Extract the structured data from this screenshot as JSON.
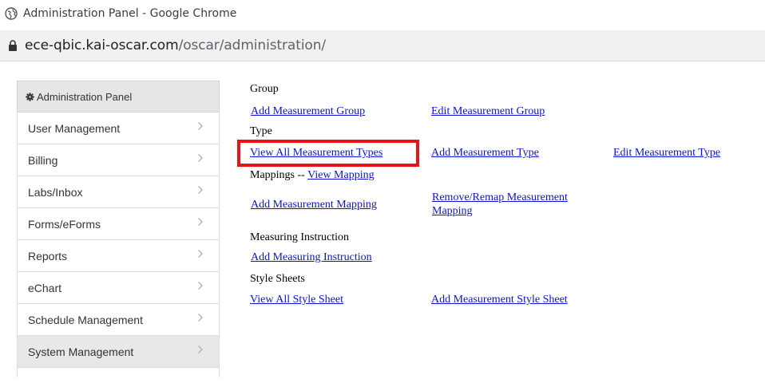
{
  "window": {
    "title": "Administration Panel - Google Chrome"
  },
  "address_bar": {
    "host": "ece-qbic.kai-oscar.com",
    "path": "/oscar/administration/"
  },
  "sidebar": {
    "header": "Administration Panel",
    "items": [
      {
        "label": "User Management"
      },
      {
        "label": "Billing"
      },
      {
        "label": "Labs/Inbox"
      },
      {
        "label": "Forms/eForms"
      },
      {
        "label": "Reports"
      },
      {
        "label": "eChart"
      },
      {
        "label": "Schedule Management"
      },
      {
        "label": "System Management"
      }
    ]
  },
  "content": {
    "group": {
      "heading": "Group",
      "add_link": "Add Measurement Group",
      "edit_link": "Edit Measurement Group"
    },
    "type": {
      "heading": "Type",
      "view_all_link": "View All Measurement Types",
      "add_link": "Add Measurement Type",
      "edit_link": "Edit Measurement Type"
    },
    "mappings": {
      "heading": "Mappings --",
      "view_link": "View Mapping",
      "add_link": "Add Measurement Mapping",
      "remove_link_line1": "Remove/Remap Measurement",
      "remove_link_line2": "Mapping"
    },
    "instruction": {
      "heading": "Measuring Instruction",
      "add_link": "Add Measuring Instruction"
    },
    "style_sheets": {
      "heading": "Style Sheets",
      "view_all_link": "View All Style Sheet",
      "add_link": "Add Measurement Style Sheet"
    }
  },
  "colors": {
    "link": "#0b12d6",
    "highlight_box": "#e8141a",
    "sidebar_active_bg": "#e8e8e8"
  }
}
